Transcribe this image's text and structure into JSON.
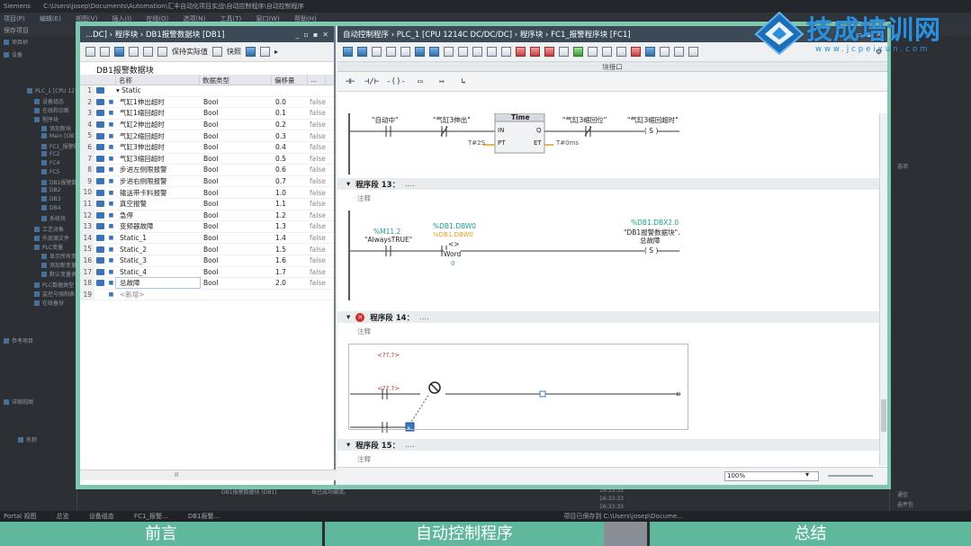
{
  "bg": {
    "title_texts": [
      "Siemens",
      "C:\\Users\\josep\\Documents\\Automation\\汇丰自动化项目实战\\自动控制程序\\自动控制程序"
    ],
    "menu_items": [
      "项目(P)",
      "编辑(E)",
      "视图(V)",
      "插入(I)",
      "在线(O)",
      "选项(N)",
      "工具(T)",
      "窗口(W)",
      "帮助(H)"
    ],
    "toolbar_save": "保存项目",
    "left_tree": [
      "PLC_1 [CPU 1214C]",
      "设备组态",
      "在线和诊断",
      "程序块",
      "添加新块",
      "Main [OB1]",
      "FC1_报警程序块",
      "FC2",
      "FC4",
      "FC5",
      "DB1报警数据块",
      "DB2",
      "DB3",
      "DB4",
      "系统块",
      "工艺对象",
      "外部源文件",
      "PLC变量",
      "显示所有变量",
      "添加新变量表",
      "默认变量表",
      "PLC数据类型",
      "监控与强制表",
      "在线备份"
    ],
    "left_panel_headers": [
      "项目树",
      "设备",
      "参考项目",
      "详细视图",
      "名称"
    ],
    "right_panel_items": [
      "选项",
      "通信",
      "选件包"
    ],
    "bottom_lines": [
      "DB1报警数据块 (DB1)",
      "块已成功编译。",
      "16:33:33",
      "16:33:33",
      "16:33:33"
    ],
    "taskbar": [
      "Portal 视图",
      "总览",
      "设备组态",
      "FC1_报警...",
      "DB1报警...",
      "项目已保存到 C:\\Users\\josep\\Docume..."
    ]
  },
  "db_panel": {
    "title_path": "...DC] › 程序块 › DB1报警数据块 [DB1]",
    "toolbar_label_snapshot": "保持实际值",
    "toolbar_label_quick": "快照",
    "block_name": "DB1报警数据块",
    "columns": [
      "名称",
      "数据类型",
      "偏移量",
      "..."
    ],
    "rows": [
      {
        "num": "1",
        "name": "▾ Static",
        "type": "",
        "offset": "",
        "more": ""
      },
      {
        "num": "2",
        "name": "气缸1伸出超时",
        "type": "Bool",
        "offset": "0.0",
        "more": "false"
      },
      {
        "num": "3",
        "name": "气缸1缩回超时",
        "type": "Bool",
        "offset": "0.1",
        "more": "false"
      },
      {
        "num": "4",
        "name": "气缸2伸出超时",
        "type": "Bool",
        "offset": "0.2",
        "more": "false"
      },
      {
        "num": "5",
        "name": "气缸2缩回超时",
        "type": "Bool",
        "offset": "0.3",
        "more": "false"
      },
      {
        "num": "6",
        "name": "气缸3伸出超时",
        "type": "Bool",
        "offset": "0.4",
        "more": "false"
      },
      {
        "num": "7",
        "name": "气缸3缩回超时",
        "type": "Bool",
        "offset": "0.5",
        "more": "false"
      },
      {
        "num": "8",
        "name": "步进左侧限报警",
        "type": "Bool",
        "offset": "0.6",
        "more": "false"
      },
      {
        "num": "9",
        "name": "步进右侧限报警",
        "type": "Bool",
        "offset": "0.7",
        "more": "false"
      },
      {
        "num": "10",
        "name": "输送带卡料报警",
        "type": "Bool",
        "offset": "1.0",
        "more": "false"
      },
      {
        "num": "11",
        "name": "真空报警",
        "type": "Bool",
        "offset": "1.1",
        "more": "false"
      },
      {
        "num": "12",
        "name": "急停",
        "type": "Bool",
        "offset": "1.2",
        "more": "false"
      },
      {
        "num": "13",
        "name": "变频器故障",
        "type": "Bool",
        "offset": "1.3",
        "more": "false"
      },
      {
        "num": "14",
        "name": "Static_1",
        "type": "Bool",
        "offset": "1.4",
        "more": "false"
      },
      {
        "num": "15",
        "name": "Static_2",
        "type": "Bool",
        "offset": "1.5",
        "more": "false"
      },
      {
        "num": "16",
        "name": "Static_3",
        "type": "Bool",
        "offset": "1.6",
        "more": "false"
      },
      {
        "num": "17",
        "name": "Static_4",
        "type": "Bool",
        "offset": "1.7",
        "more": "false"
      },
      {
        "num": "18",
        "name": "总故障",
        "type": "Bool",
        "offset": "2.0",
        "more": "false"
      },
      {
        "num": "19",
        "name": "<新增>",
        "type": "",
        "offset": "",
        "more": ""
      }
    ],
    "hscroll_label": "II"
  },
  "prog_panel": {
    "title_path": "自动控制程序 › PLC_1 [CPU 1214C DC/DC/DC] › 程序块 › FC1_报警程序块 [FC1]",
    "block_interface": "块接口",
    "instr": [
      "⊣⊢",
      "⊣/⊢",
      "-()-",
      "▭",
      "↦",
      "↳"
    ],
    "net12": {
      "contact1": "\"自动中\"",
      "contact2": "\"气缸3伸出\"",
      "timer": "Time",
      "timer_in": "IN",
      "timer_q": "Q",
      "timer_pt": "PT",
      "timer_et": "ET",
      "pt_value": "T#2S",
      "et_value": "T#0ms",
      "contact3": "\"气缸3缩回位\"",
      "coil": "\"气缸3缩回超时\"",
      "coil_sym": "( S )"
    },
    "net13": {
      "label": "程序段 13：",
      "dots": "....",
      "comment": "注释",
      "contact_addr": "%M11.2",
      "contact_sym": "\"AlwaysTRUE\"",
      "cmp_addr": "%DB1.DBW0",
      "cmp_addr2": "%DB1.DBW0",
      "cmp_op": "<>",
      "cmp_type": "Word",
      "cmp_val": "0",
      "coil_addr": "%DB1.DBX2.0",
      "coil_sym": "\"DB1报警数据块\".",
      "coil_sym2": "总故障",
      "coil_mark": "( S )"
    },
    "net14": {
      "label": "程序段 14：",
      "dots": "....",
      "comment": "注释",
      "err": "✕",
      "op1": "<??.?>",
      "op2": "<??.?>"
    },
    "net15": {
      "label": "程序段 15：",
      "dots": "....",
      "comment": "注释"
    },
    "zoom": "100%"
  },
  "logo": {
    "title": "技成培训网",
    "url": "www.jcpeixun.com"
  },
  "chapters": [
    "前言",
    "自动控制程序",
    "总结"
  ],
  "colors": {
    "accent_green": "#5fb79c",
    "frame_green": "#7fc8b0",
    "brand_blue": "#2f8fd9",
    "error_red": "#d02a2a",
    "db_teal": "#1b9c8c"
  }
}
